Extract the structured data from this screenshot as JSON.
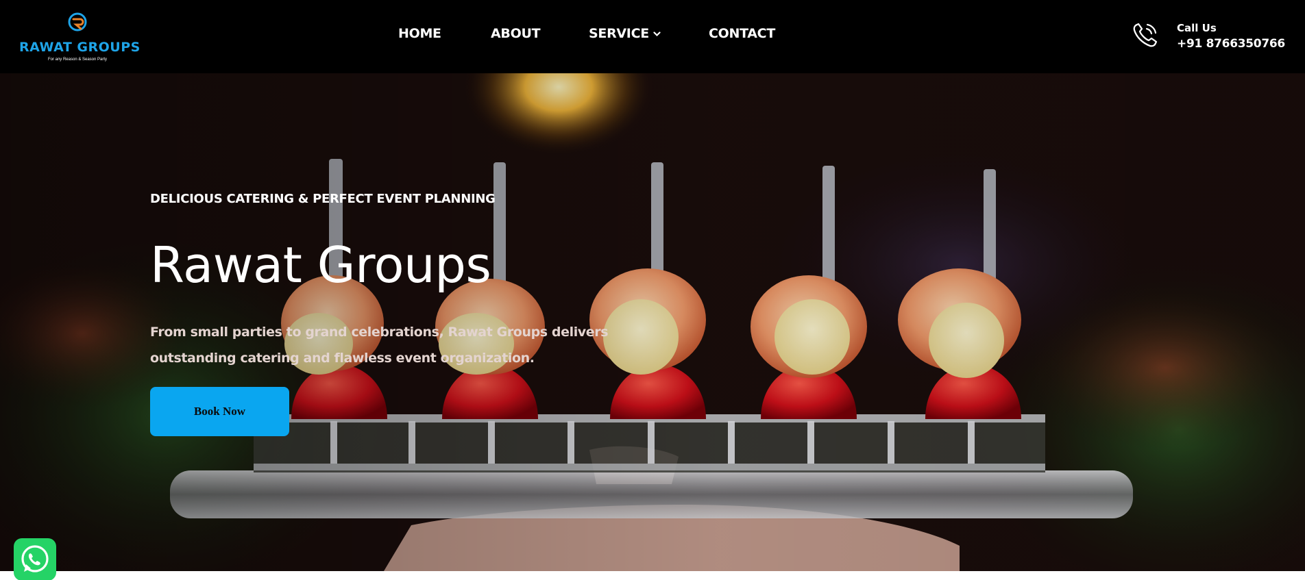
{
  "brand": {
    "name": "RAWAT GROUPS",
    "tagline": "For any Reason & Season Party",
    "color": "#1ea4e8"
  },
  "nav": {
    "items": [
      {
        "label": "HOME"
      },
      {
        "label": "ABOUT"
      },
      {
        "label": "SERVICE",
        "icon": "chevron-down-icon"
      },
      {
        "label": "CONTACT"
      }
    ]
  },
  "contact": {
    "label": "Call Us",
    "phone": "+91 8766350766",
    "icon": "phone-icon"
  },
  "hero": {
    "eyebrow": "DELICIOUS CATERING & PERFECT EVENT PLANNING",
    "title": "Rawat Groups",
    "description": "From small parties to grand celebrations, Rawat Groups delivers outstanding catering and flawless event organization.",
    "cta_label": "Book Now",
    "cta_color": "#0aa6f0"
  },
  "floating": {
    "whatsapp_icon": "whatsapp-icon",
    "whatsapp_color": "#25d366"
  }
}
